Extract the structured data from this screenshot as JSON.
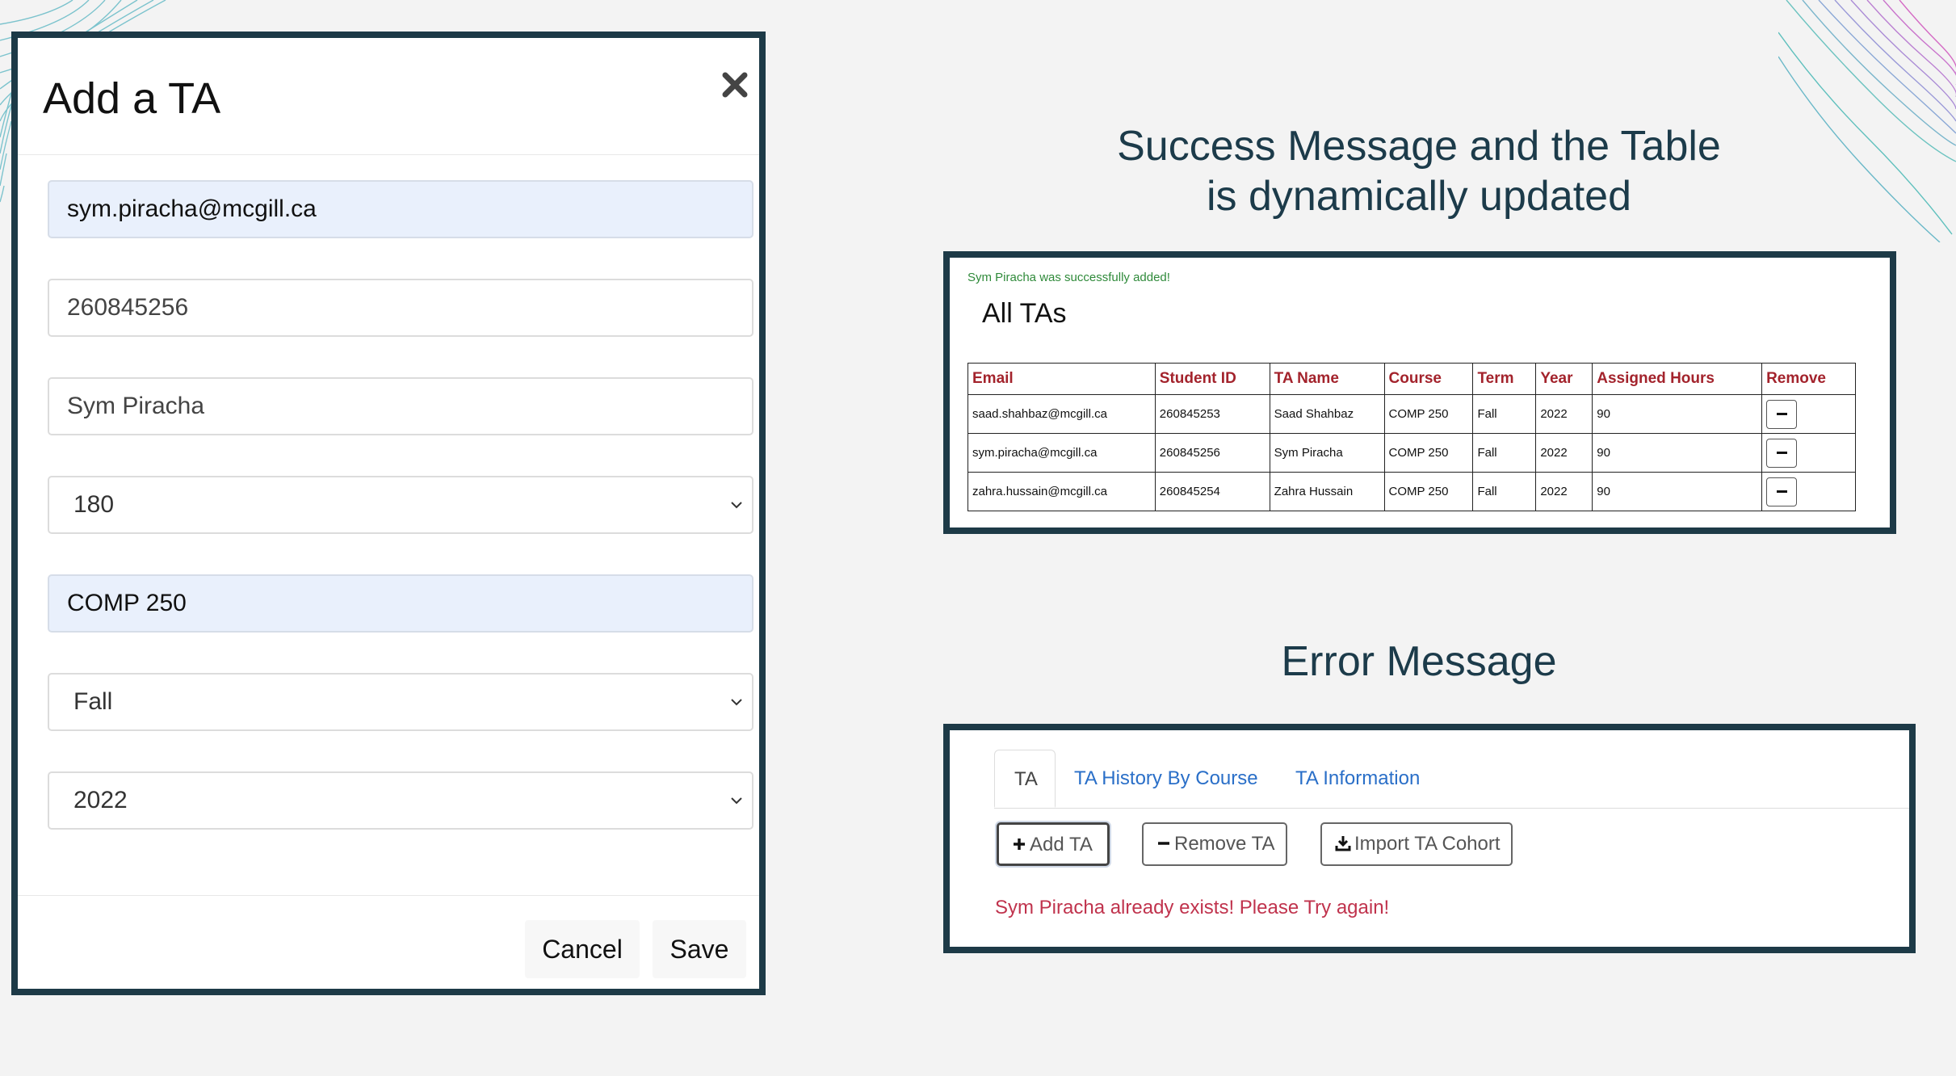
{
  "modal": {
    "title": "Add a TA",
    "close_icon": "close-icon",
    "fields": {
      "email": "sym.piracha@mcgill.ca",
      "student_id": "260845256",
      "name": "Sym Piracha",
      "hours": "180",
      "course": "COMP 250",
      "term": "Fall",
      "year": "2022"
    },
    "cancel_label": "Cancel",
    "save_label": "Save"
  },
  "success_section": {
    "heading_line1": "Success Message and the Table",
    "heading_line2": "is dynamically updated",
    "message": "Sym Piracha was successfully added!",
    "table_title": "All TAs",
    "columns": [
      "Email",
      "Student ID",
      "TA Name",
      "Course",
      "Term",
      "Year",
      "Assigned Hours",
      "Remove"
    ],
    "rows": [
      [
        "saad.shahbaz@mcgill.ca",
        "260845253",
        "Saad Shahbaz",
        "COMP 250",
        "Fall",
        "2022",
        "90"
      ],
      [
        "sym.piracha@mcgill.ca",
        "260845256",
        "Sym Piracha",
        "COMP 250",
        "Fall",
        "2022",
        "90"
      ],
      [
        "zahra.hussain@mcgill.ca",
        "260845254",
        "Zahra Hussain",
        "COMP 250",
        "Fall",
        "2022",
        "90"
      ]
    ]
  },
  "error_section": {
    "heading": "Error Message",
    "tabs": [
      "TA",
      "TA History By Course",
      "TA Information"
    ],
    "buttons": {
      "add": "Add TA",
      "remove": "Remove TA",
      "import": "Import TA Cohort"
    },
    "message": "Sym Piracha already exists! Please Try again!"
  },
  "colors": {
    "frame": "#1d3a47",
    "success_text": "#2f8a3a",
    "error_text": "#c0334d",
    "table_header": "#a3232c",
    "link": "#2a6fc8"
  }
}
